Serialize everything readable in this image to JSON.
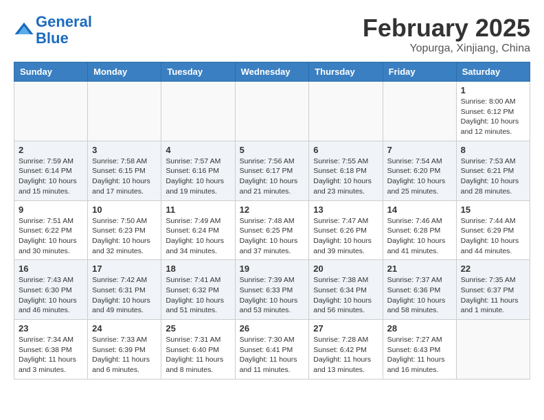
{
  "header": {
    "logo_line1": "General",
    "logo_line2": "Blue",
    "month_title": "February 2025",
    "location": "Yopurga, Xinjiang, China"
  },
  "days_of_week": [
    "Sunday",
    "Monday",
    "Tuesday",
    "Wednesday",
    "Thursday",
    "Friday",
    "Saturday"
  ],
  "weeks": [
    [
      {
        "day": "",
        "info": ""
      },
      {
        "day": "",
        "info": ""
      },
      {
        "day": "",
        "info": ""
      },
      {
        "day": "",
        "info": ""
      },
      {
        "day": "",
        "info": ""
      },
      {
        "day": "",
        "info": ""
      },
      {
        "day": "1",
        "info": "Sunrise: 8:00 AM\nSunset: 6:12 PM\nDaylight: 10 hours\nand 12 minutes."
      }
    ],
    [
      {
        "day": "2",
        "info": "Sunrise: 7:59 AM\nSunset: 6:14 PM\nDaylight: 10 hours\nand 15 minutes."
      },
      {
        "day": "3",
        "info": "Sunrise: 7:58 AM\nSunset: 6:15 PM\nDaylight: 10 hours\nand 17 minutes."
      },
      {
        "day": "4",
        "info": "Sunrise: 7:57 AM\nSunset: 6:16 PM\nDaylight: 10 hours\nand 19 minutes."
      },
      {
        "day": "5",
        "info": "Sunrise: 7:56 AM\nSunset: 6:17 PM\nDaylight: 10 hours\nand 21 minutes."
      },
      {
        "day": "6",
        "info": "Sunrise: 7:55 AM\nSunset: 6:18 PM\nDaylight: 10 hours\nand 23 minutes."
      },
      {
        "day": "7",
        "info": "Sunrise: 7:54 AM\nSunset: 6:20 PM\nDaylight: 10 hours\nand 25 minutes."
      },
      {
        "day": "8",
        "info": "Sunrise: 7:53 AM\nSunset: 6:21 PM\nDaylight: 10 hours\nand 28 minutes."
      }
    ],
    [
      {
        "day": "9",
        "info": "Sunrise: 7:51 AM\nSunset: 6:22 PM\nDaylight: 10 hours\nand 30 minutes."
      },
      {
        "day": "10",
        "info": "Sunrise: 7:50 AM\nSunset: 6:23 PM\nDaylight: 10 hours\nand 32 minutes."
      },
      {
        "day": "11",
        "info": "Sunrise: 7:49 AM\nSunset: 6:24 PM\nDaylight: 10 hours\nand 34 minutes."
      },
      {
        "day": "12",
        "info": "Sunrise: 7:48 AM\nSunset: 6:25 PM\nDaylight: 10 hours\nand 37 minutes."
      },
      {
        "day": "13",
        "info": "Sunrise: 7:47 AM\nSunset: 6:26 PM\nDaylight: 10 hours\nand 39 minutes."
      },
      {
        "day": "14",
        "info": "Sunrise: 7:46 AM\nSunset: 6:28 PM\nDaylight: 10 hours\nand 41 minutes."
      },
      {
        "day": "15",
        "info": "Sunrise: 7:44 AM\nSunset: 6:29 PM\nDaylight: 10 hours\nand 44 minutes."
      }
    ],
    [
      {
        "day": "16",
        "info": "Sunrise: 7:43 AM\nSunset: 6:30 PM\nDaylight: 10 hours\nand 46 minutes."
      },
      {
        "day": "17",
        "info": "Sunrise: 7:42 AM\nSunset: 6:31 PM\nDaylight: 10 hours\nand 49 minutes."
      },
      {
        "day": "18",
        "info": "Sunrise: 7:41 AM\nSunset: 6:32 PM\nDaylight: 10 hours\nand 51 minutes."
      },
      {
        "day": "19",
        "info": "Sunrise: 7:39 AM\nSunset: 6:33 PM\nDaylight: 10 hours\nand 53 minutes."
      },
      {
        "day": "20",
        "info": "Sunrise: 7:38 AM\nSunset: 6:34 PM\nDaylight: 10 hours\nand 56 minutes."
      },
      {
        "day": "21",
        "info": "Sunrise: 7:37 AM\nSunset: 6:36 PM\nDaylight: 10 hours\nand 58 minutes."
      },
      {
        "day": "22",
        "info": "Sunrise: 7:35 AM\nSunset: 6:37 PM\nDaylight: 11 hours\nand 1 minute."
      }
    ],
    [
      {
        "day": "23",
        "info": "Sunrise: 7:34 AM\nSunset: 6:38 PM\nDaylight: 11 hours\nand 3 minutes."
      },
      {
        "day": "24",
        "info": "Sunrise: 7:33 AM\nSunset: 6:39 PM\nDaylight: 11 hours\nand 6 minutes."
      },
      {
        "day": "25",
        "info": "Sunrise: 7:31 AM\nSunset: 6:40 PM\nDaylight: 11 hours\nand 8 minutes."
      },
      {
        "day": "26",
        "info": "Sunrise: 7:30 AM\nSunset: 6:41 PM\nDaylight: 11 hours\nand 11 minutes."
      },
      {
        "day": "27",
        "info": "Sunrise: 7:28 AM\nSunset: 6:42 PM\nDaylight: 11 hours\nand 13 minutes."
      },
      {
        "day": "28",
        "info": "Sunrise: 7:27 AM\nSunset: 6:43 PM\nDaylight: 11 hours\nand 16 minutes."
      },
      {
        "day": "",
        "info": ""
      }
    ]
  ]
}
